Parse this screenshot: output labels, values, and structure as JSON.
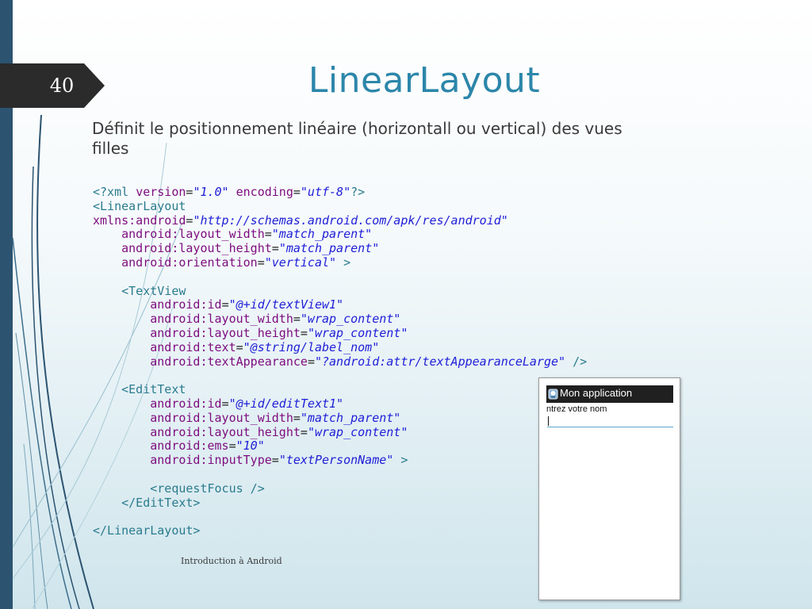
{
  "slide": {
    "number": "40",
    "title": "LinearLayout",
    "subtitle": "Définit le positionnement linéaire (horizontall ou vertical) des vues filles",
    "footer": "Introduction à Android"
  },
  "code": {
    "lines": [
      [
        [
          "t",
          "<?xml "
        ],
        [
          "a",
          "version"
        ],
        [
          "p",
          "="
        ],
        [
          "v",
          "\"1.0\""
        ],
        [
          "p",
          " "
        ],
        [
          "a",
          "encoding"
        ],
        [
          "p",
          "="
        ],
        [
          "v",
          "\"utf-8\""
        ],
        [
          "t",
          "?>"
        ]
      ],
      [
        [
          "t",
          "<LinearLayout"
        ]
      ],
      [
        [
          "a",
          "xmlns:android"
        ],
        [
          "p",
          "="
        ],
        [
          "v",
          "\"http://schemas.android.com/apk/res/android\""
        ]
      ],
      [
        [
          "p",
          "    "
        ],
        [
          "a",
          "android:layout_width"
        ],
        [
          "p",
          "="
        ],
        [
          "v",
          "\"match_parent\""
        ]
      ],
      [
        [
          "p",
          "    "
        ],
        [
          "a",
          "android:layout_height"
        ],
        [
          "p",
          "="
        ],
        [
          "v",
          "\"match_parent\""
        ]
      ],
      [
        [
          "p",
          "    "
        ],
        [
          "a",
          "android:orientation"
        ],
        [
          "p",
          "="
        ],
        [
          "v",
          "\"vertical\""
        ],
        [
          "p",
          " "
        ],
        [
          "t",
          ">"
        ]
      ],
      [],
      [
        [
          "p",
          "    "
        ],
        [
          "t",
          "<TextView"
        ]
      ],
      [
        [
          "p",
          "        "
        ],
        [
          "a",
          "android:id"
        ],
        [
          "p",
          "="
        ],
        [
          "v",
          "\"@+id/textView1\""
        ]
      ],
      [
        [
          "p",
          "        "
        ],
        [
          "a",
          "android:layout_width"
        ],
        [
          "p",
          "="
        ],
        [
          "v",
          "\"wrap_content\""
        ]
      ],
      [
        [
          "p",
          "        "
        ],
        [
          "a",
          "android:layout_height"
        ],
        [
          "p",
          "="
        ],
        [
          "v",
          "\"wrap_content\""
        ]
      ],
      [
        [
          "p",
          "        "
        ],
        [
          "a",
          "android:text"
        ],
        [
          "p",
          "="
        ],
        [
          "v",
          "\"@string/label_nom\""
        ]
      ],
      [
        [
          "p",
          "        "
        ],
        [
          "a",
          "android:textAppearance"
        ],
        [
          "p",
          "="
        ],
        [
          "v",
          "\"?android:attr/textAppearanceLarge\""
        ],
        [
          "p",
          " "
        ],
        [
          "t",
          "/>"
        ]
      ],
      [],
      [
        [
          "p",
          "    "
        ],
        [
          "t",
          "<EditText"
        ]
      ],
      [
        [
          "p",
          "        "
        ],
        [
          "a",
          "android:id"
        ],
        [
          "p",
          "="
        ],
        [
          "v",
          "\"@+id/editText1\""
        ]
      ],
      [
        [
          "p",
          "        "
        ],
        [
          "a",
          "android:layout_width"
        ],
        [
          "p",
          "="
        ],
        [
          "v",
          "\"match_parent\""
        ]
      ],
      [
        [
          "p",
          "        "
        ],
        [
          "a",
          "android:layout_height"
        ],
        [
          "p",
          "="
        ],
        [
          "v",
          "\"wrap_content\""
        ]
      ],
      [
        [
          "p",
          "        "
        ],
        [
          "a",
          "android:ems"
        ],
        [
          "p",
          "="
        ],
        [
          "v",
          "\"10\""
        ]
      ],
      [
        [
          "p",
          "        "
        ],
        [
          "a",
          "android:inputType"
        ],
        [
          "p",
          "="
        ],
        [
          "v",
          "\"textPersonName\""
        ],
        [
          "p",
          " "
        ],
        [
          "t",
          ">"
        ]
      ],
      [],
      [
        [
          "p",
          "        "
        ],
        [
          "t",
          "<requestFocus />"
        ]
      ],
      [
        [
          "p",
          "    "
        ],
        [
          "t",
          "</EditText>"
        ]
      ],
      [],
      [
        [
          "t",
          "</LinearLayout>"
        ]
      ]
    ]
  },
  "phone": {
    "app_title": "Mon application",
    "label": "ntrez votre nom"
  },
  "colors": {
    "title": "#2c86aa",
    "tag": "#2b7b8e",
    "attribute": "#7d0d7d",
    "value": "#2020d6",
    "left_band": "#2c5370",
    "number_tab": "#2b2b2b"
  }
}
